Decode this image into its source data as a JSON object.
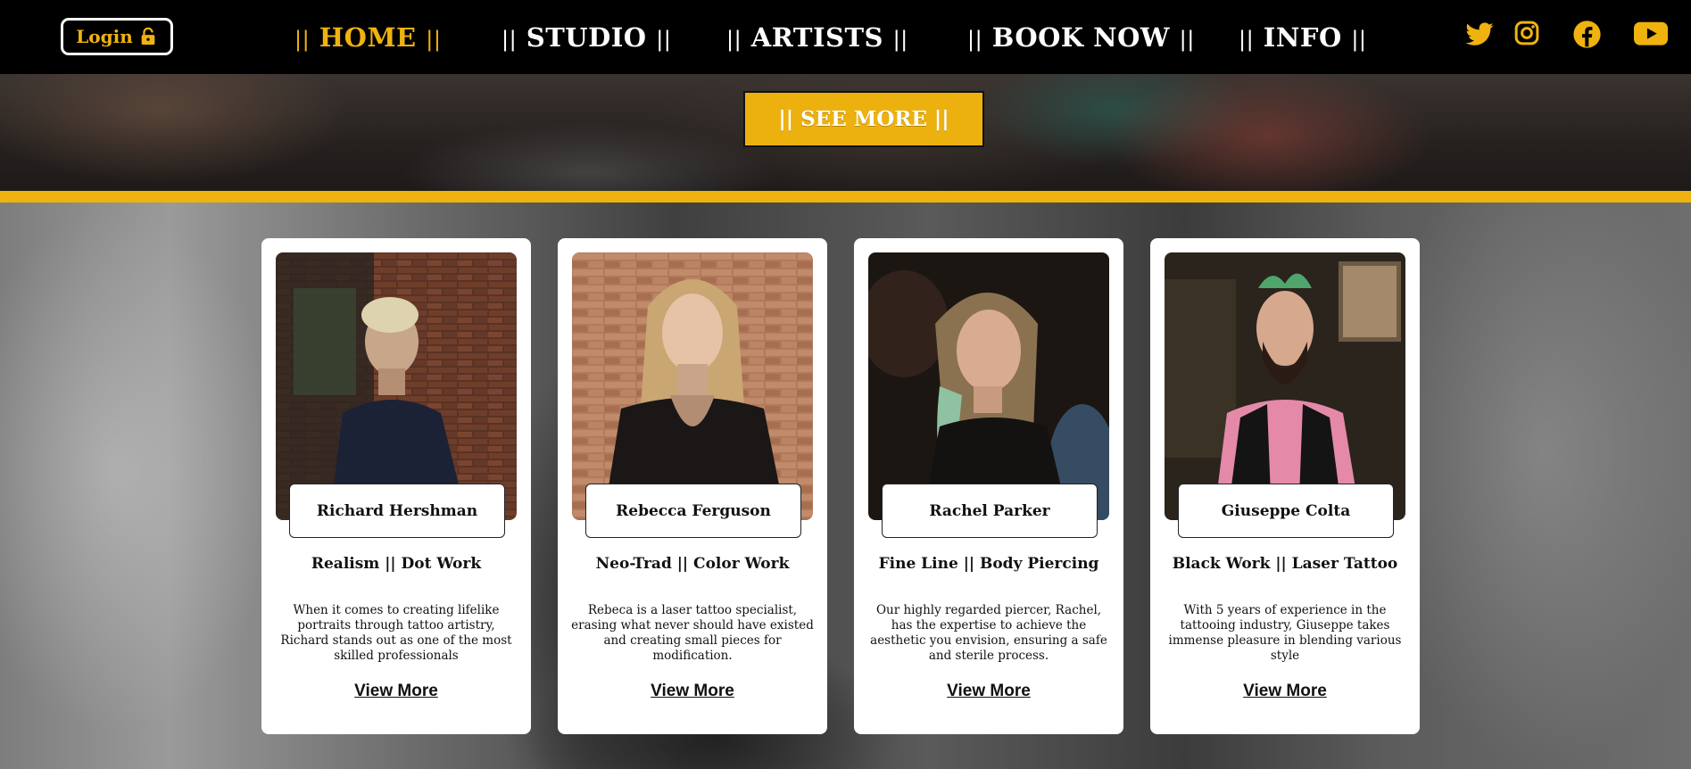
{
  "nav": {
    "login_label": "Login",
    "login_icon": "lock-icon",
    "links": [
      {
        "label": "HOME",
        "active": true
      },
      {
        "label": "STUDIO",
        "active": false
      },
      {
        "label": "ARTISTS",
        "active": false
      },
      {
        "label": "BOOK NOW",
        "active": false
      },
      {
        "label": "INFO",
        "active": false
      }
    ],
    "separator": "||",
    "social_icons": [
      "twitter-icon",
      "instagram-icon",
      "facebook-icon",
      "youtube-icon"
    ]
  },
  "hero": {
    "see_more_label": "|| SEE MORE ||"
  },
  "artists": [
    {
      "name": "Richard Hershman",
      "specialty": "Realism || Dot Work",
      "description": "When it comes to creating lifelike portraits through tattoo artistry, Richard stands out as one of the most skilled professionals",
      "link_label": "View More"
    },
    {
      "name": "Rebecca Ferguson",
      "specialty": "Neo-Trad || Color Work",
      "description": "Rebeca is a laser tattoo specialist, erasing what never should have existed and creating small pieces for modification.",
      "link_label": "View More"
    },
    {
      "name": "Rachel Parker",
      "specialty": "Fine Line || Body Piercing",
      "description": "Our highly regarded piercer, Rachel, has the expertise to achieve the aesthetic you envision, ensuring a safe and sterile process.",
      "link_label": "View More"
    },
    {
      "name": "Giuseppe Colta",
      "specialty": "Black Work || Laser Tattoo",
      "description": "With 5 years of experience in the tattooing industry, Giuseppe takes immense pleasure in blending various style",
      "link_label": "View More"
    }
  ],
  "colors": {
    "accent": "#f0b20f",
    "nav_bg": "#000000",
    "card_bg": "#ffffff"
  }
}
